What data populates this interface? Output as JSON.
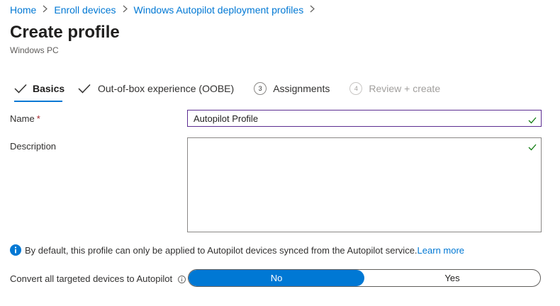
{
  "breadcrumb": {
    "items": [
      "Home",
      "Enroll devices",
      "Windows Autopilot deployment profiles"
    ],
    "separator": ">"
  },
  "page": {
    "title": "Create profile",
    "subtitle": "Windows PC"
  },
  "steps": [
    {
      "label": "Basics",
      "state": "active",
      "marker": "check"
    },
    {
      "label": "Out-of-box experience (OOBE)",
      "state": "complete",
      "marker": "check"
    },
    {
      "label": "Assignments",
      "state": "pending",
      "marker": "3"
    },
    {
      "label": "Review + create",
      "state": "disabled",
      "marker": "4"
    }
  ],
  "form": {
    "name_label": "Name",
    "required_marker": "*",
    "name_value": "Autopilot Profile",
    "description_label": "Description",
    "description_value": ""
  },
  "info": {
    "text": "By default, this profile can only be applied to Autopilot devices synced from the Autopilot service.",
    "link": "Learn more"
  },
  "convert": {
    "label": "Convert all targeted devices to Autopilot",
    "options": [
      "No",
      "Yes"
    ],
    "selected": "No"
  },
  "icons": {
    "valid": "checkmark-icon",
    "info": "info-icon",
    "help": "help-circle-icon",
    "breadcrumb_separator": "chevron-right-icon"
  },
  "colors": {
    "accent": "#0078d4",
    "valid_check": "#107c10",
    "input_focus_border": "#5c2d91",
    "required": "#a4262c"
  }
}
